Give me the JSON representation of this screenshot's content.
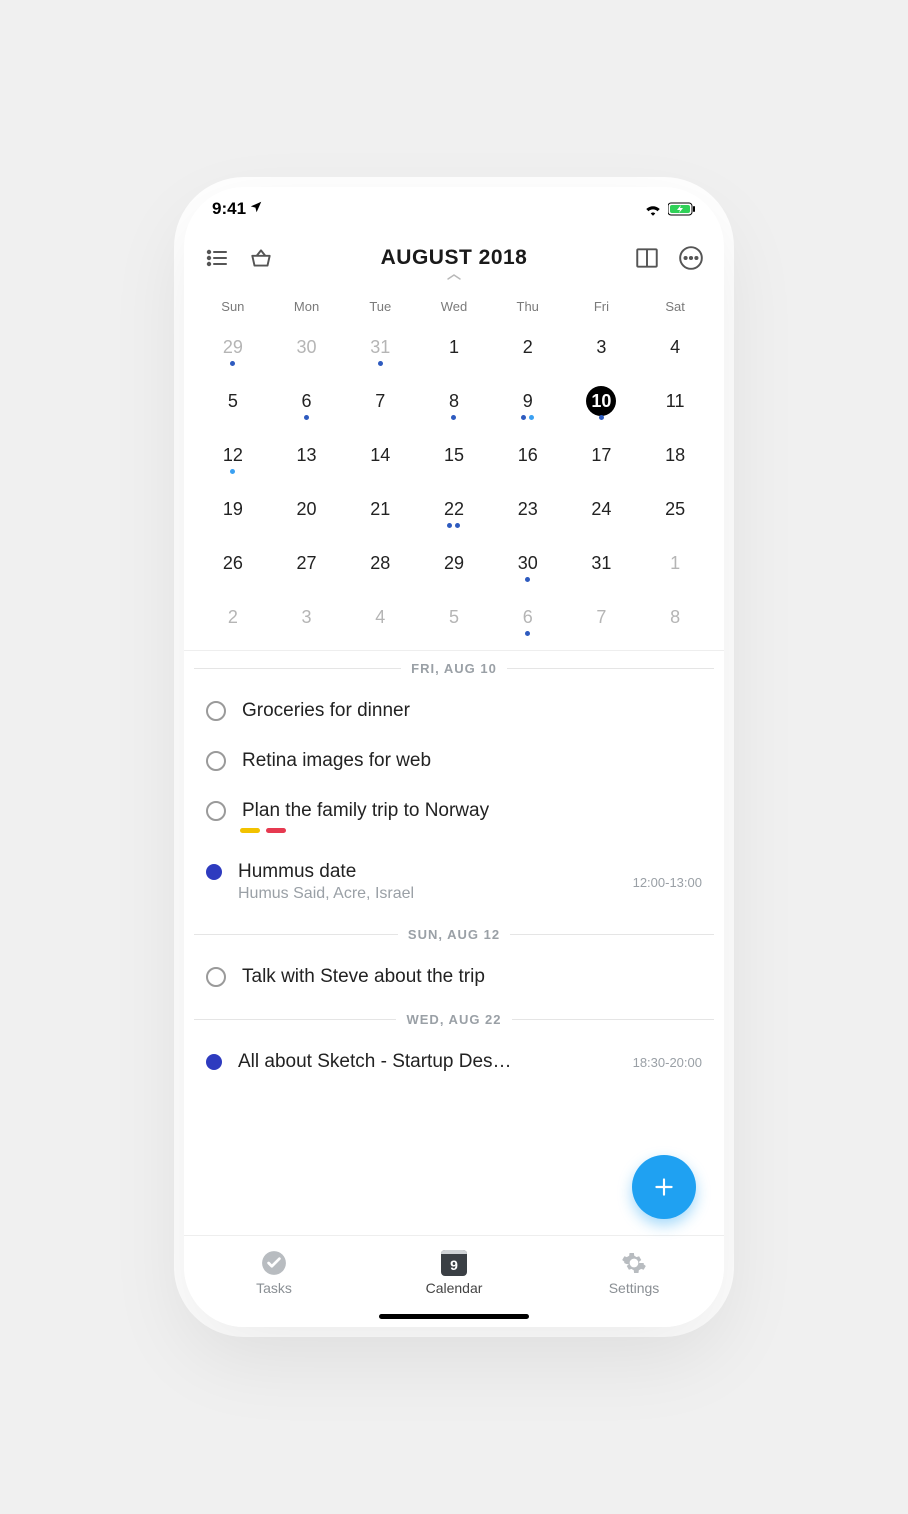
{
  "statusbar": {
    "time": "9:41"
  },
  "toolbar": {
    "title": "AUGUST 2018"
  },
  "dow": [
    "Sun",
    "Mon",
    "Tue",
    "Wed",
    "Thu",
    "Fri",
    "Sat"
  ],
  "weeks": [
    [
      {
        "n": "29",
        "other": true,
        "dots": [
          "blue"
        ]
      },
      {
        "n": "30",
        "other": true
      },
      {
        "n": "31",
        "other": true,
        "dots": [
          "blue"
        ]
      },
      {
        "n": "1"
      },
      {
        "n": "2"
      },
      {
        "n": "3"
      },
      {
        "n": "4"
      }
    ],
    [
      {
        "n": "5"
      },
      {
        "n": "6",
        "dots": [
          "blue"
        ]
      },
      {
        "n": "7"
      },
      {
        "n": "8",
        "dots": [
          "blue"
        ]
      },
      {
        "n": "9",
        "dots": [
          "blue",
          "light"
        ]
      },
      {
        "n": "10",
        "selected": true,
        "dots": [
          "blue"
        ]
      },
      {
        "n": "11"
      }
    ],
    [
      {
        "n": "12",
        "dots": [
          "light"
        ]
      },
      {
        "n": "13"
      },
      {
        "n": "14"
      },
      {
        "n": "15"
      },
      {
        "n": "16"
      },
      {
        "n": "17"
      },
      {
        "n": "18"
      }
    ],
    [
      {
        "n": "19"
      },
      {
        "n": "20"
      },
      {
        "n": "21"
      },
      {
        "n": "22",
        "dots": [
          "blue",
          "blue"
        ]
      },
      {
        "n": "23"
      },
      {
        "n": "24"
      },
      {
        "n": "25"
      }
    ],
    [
      {
        "n": "26"
      },
      {
        "n": "27"
      },
      {
        "n": "28"
      },
      {
        "n": "29"
      },
      {
        "n": "30",
        "dots": [
          "blue"
        ]
      },
      {
        "n": "31"
      },
      {
        "n": "1",
        "other": true
      }
    ],
    [
      {
        "n": "2",
        "other": true
      },
      {
        "n": "3",
        "other": true
      },
      {
        "n": "4",
        "other": true
      },
      {
        "n": "5",
        "other": true
      },
      {
        "n": "6",
        "other": true,
        "dots": [
          "blue"
        ]
      },
      {
        "n": "7",
        "other": true
      },
      {
        "n": "8",
        "other": true
      }
    ]
  ],
  "agenda": [
    {
      "type": "header",
      "label": "FRI, AUG 10"
    },
    {
      "type": "task",
      "title": "Groceries for dinner"
    },
    {
      "type": "task",
      "title": "Retina images for web"
    },
    {
      "type": "task",
      "title": "Plan the family trip to Norway",
      "tags": [
        "yellow",
        "red"
      ]
    },
    {
      "type": "event",
      "title": "Hummus date",
      "sub": "Humus Said, Acre, Israel",
      "time": "12:00-13:00"
    },
    {
      "type": "header",
      "label": "SUN, AUG 12"
    },
    {
      "type": "task",
      "title": "Talk with Steve about the trip"
    },
    {
      "type": "header",
      "label": "WED, AUG 22"
    },
    {
      "type": "event",
      "title": "All about Sketch - Startup Des…",
      "time": "18:30-20:00"
    }
  ],
  "tabs": {
    "tasks": "Tasks",
    "calendar": "Calendar",
    "calendar_day": "9",
    "settings": "Settings"
  }
}
